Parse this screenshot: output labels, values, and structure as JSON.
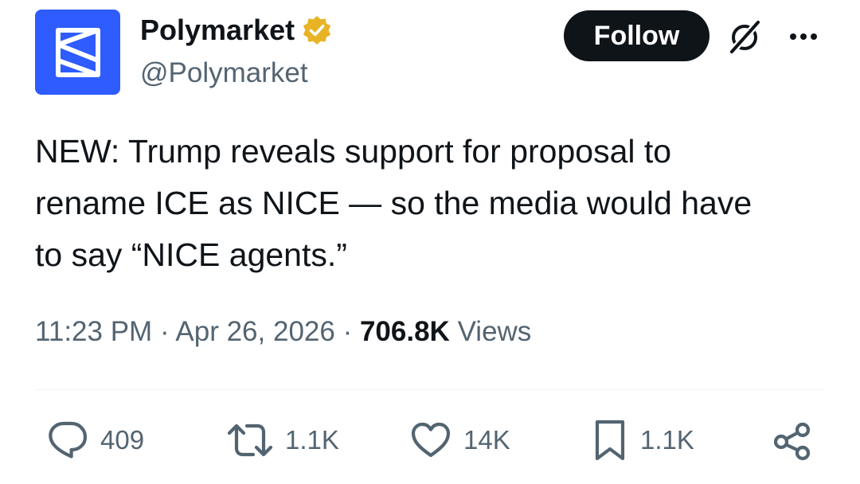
{
  "account": {
    "display_name": "Polymarket",
    "handle": "@Polymarket",
    "avatar_color": "#2e5cff",
    "verified_badge_color": "#e8b325"
  },
  "header": {
    "follow_label": "Follow"
  },
  "tweet": {
    "text_lines": [
      "NEW: Trump reveals support for proposal to",
      "rename ICE as NICE — so the media would have",
      "to say “NICE agents.”"
    ],
    "time": "11:23 PM",
    "separator": "·",
    "date": "Apr 26, 2026",
    "views_count": "706.8K",
    "views_label": "Views"
  },
  "actions": {
    "replies": "409",
    "reposts": "1.1K",
    "likes": "14K",
    "bookmarks": "1.1K"
  },
  "icons": [
    "verified-badge-icon",
    "grok-icon",
    "more-icon",
    "reply-icon",
    "repost-icon",
    "like-icon",
    "bookmark-icon",
    "share-icon"
  ]
}
